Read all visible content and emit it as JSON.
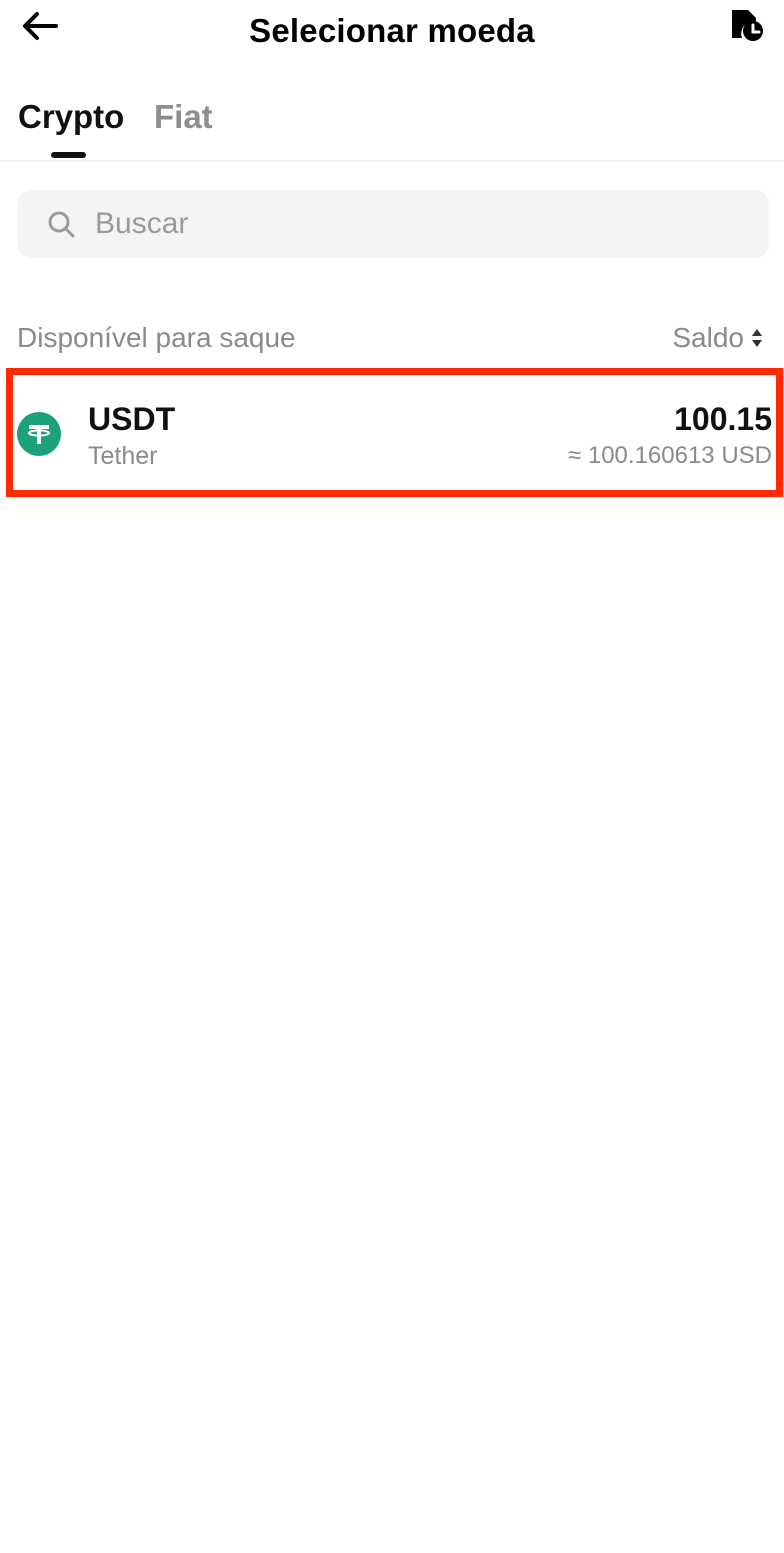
{
  "header": {
    "title": "Selecionar moeda",
    "back_icon": "arrow-left-icon",
    "history_icon": "history-clock-icon"
  },
  "tabs": [
    {
      "label": "Crypto",
      "active": true
    },
    {
      "label": "Fiat",
      "active": false
    }
  ],
  "search": {
    "placeholder": "Buscar",
    "value": ""
  },
  "list": {
    "section_label": "Disponível para saque",
    "sort_label": "Saldo",
    "items": [
      {
        "symbol": "USDT",
        "name": "Tether",
        "balance": "100.15",
        "fiat_value": "≈ 100.160613 USD",
        "logo_color": "#1BA27A"
      }
    ]
  },
  "colors": {
    "highlight_border": "#FF2A00",
    "accent_text": "#111111",
    "muted_text": "#8A8A8A"
  }
}
